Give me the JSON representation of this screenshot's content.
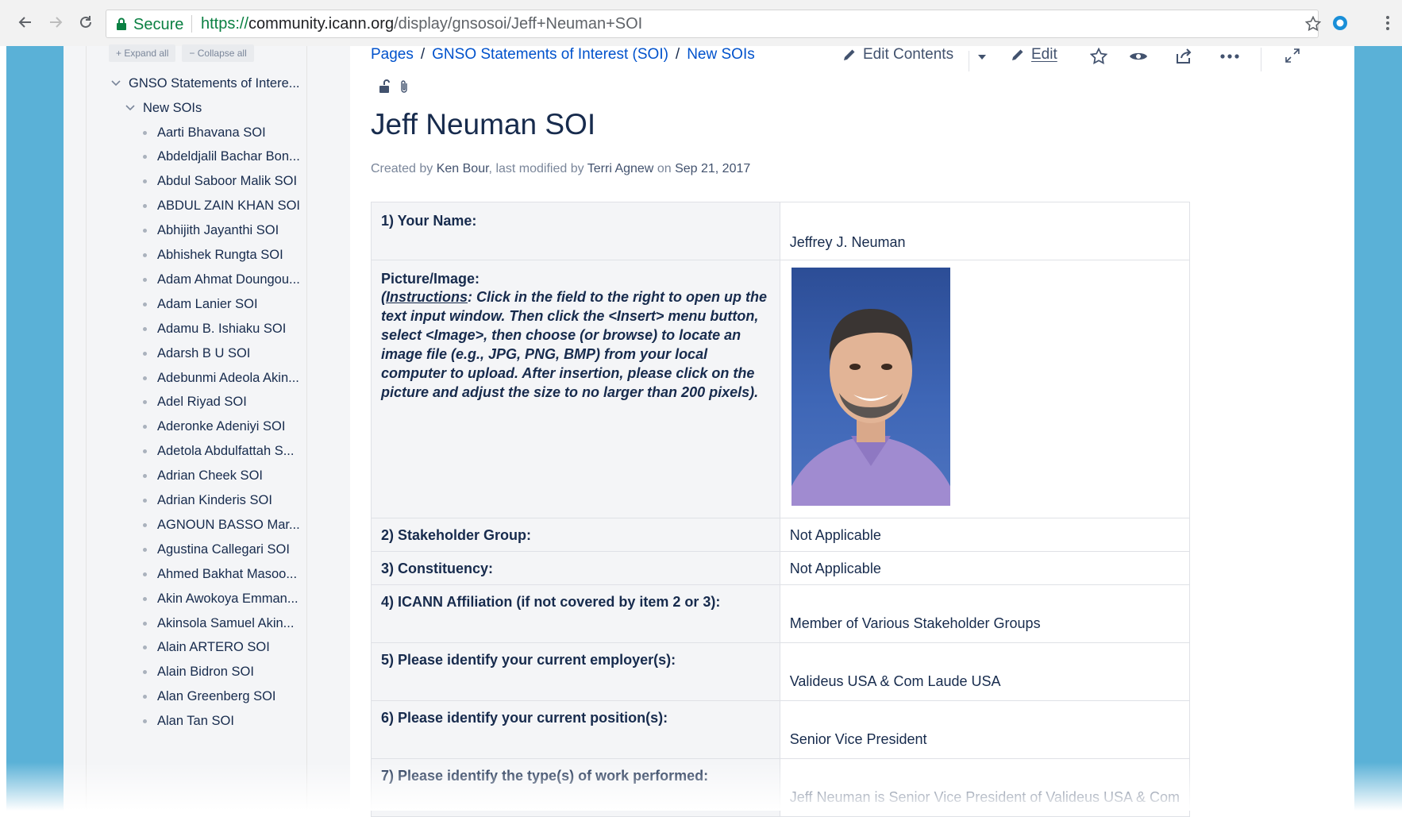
{
  "browser": {
    "secure_label": "Secure",
    "url_protocol": "https://",
    "url_host": "community.icann.org",
    "url_path": "/display/gnsosoi/Jeff+Neuman+SOI"
  },
  "sidebar": {
    "expand_all": "Expand all",
    "collapse_all": "Collapse all",
    "root": "GNSO Statements of Intere...",
    "folder": "New SOIs",
    "items": [
      "Aarti Bhavana SOI",
      "Abdeldjalil Bachar Bon...",
      "Abdul Saboor Malik SOI",
      "ABDUL ZAIN KHAN SOI",
      "Abhijith Jayanthi SOI",
      "Abhishek Rungta SOI",
      "Adam Ahmat Doungou...",
      "Adam Lanier SOI",
      "Adamu B. Ishiaku SOI",
      "Adarsh B U SOI",
      "Adebunmi Adeola Akin...",
      "Adel Riyad SOI",
      "Aderonke Adeniyi SOI",
      "Adetola Abdulfattah S...",
      "Adrian Cheek SOI",
      "Adrian Kinderis SOI",
      "AGNOUN BASSO Mar...",
      "Agustina Callegari SOI",
      "Ahmed Bakhat Masoo...",
      "Akin Awokoya Emman...",
      "Akinsola Samuel Akin...",
      "Alain ARTERO SOI",
      "Alain Bidron SOI",
      "Alan Greenberg SOI",
      "Alan Tan SOI"
    ]
  },
  "breadcrumb": {
    "pages": "Pages",
    "parent": "GNSO Statements of Interest (SOI)",
    "current": "New SOIs",
    "separator": "/"
  },
  "toolbar": {
    "edit_contents": "Edit Contents",
    "edit": "Edit"
  },
  "page": {
    "title": "Jeff Neuman SOI",
    "byline": {
      "created_by_label": "Created by",
      "creator": "Ken Bour",
      "modified_label": ", last modified by",
      "modifier": "Terri Agnew",
      "on_label": "on",
      "date": "Sep 21, 2017"
    }
  },
  "soi_table": {
    "rows": [
      {
        "question": "1) Your Name:",
        "answer": "Jeffrey J. Neuman"
      },
      {
        "question": "Picture/Image:",
        "instructions_label": "Instructions",
        "instructions_text": ": Click in the field to the right to open up the text input window. Then click the <Insert> menu button, select <Image>, then choose (or browse) to locate an image file (e.g., JPG, PNG, BMP) from your local computer to upload. After insertion, please click on the picture and adjust the size to no larger than 200 pixels)."
      },
      {
        "question": "2) Stakeholder Group:",
        "answer": "Not Applicable"
      },
      {
        "question": "3) Constituency:",
        "answer": "Not Applicable"
      },
      {
        "question": "4) ICANN Affiliation (if not covered by item 2 or 3):",
        "answer": "Member of Various Stakeholder Groups"
      },
      {
        "question": "5) Please identify your current employer(s):",
        "answer": "Valideus USA & Com Laude USA"
      },
      {
        "question": "6) Please identify your current position(s):",
        "answer": "Senior Vice President"
      },
      {
        "question": "7) Please identify the type(s) of work performed:",
        "answer": "Jeff Neuman is Senior Vice President of Valideus USA & Com"
      }
    ]
  },
  "colors": {
    "accent_link": "#0052cc",
    "page_bg_side": "#5ab1d7",
    "secure_green": "#0b8043"
  }
}
